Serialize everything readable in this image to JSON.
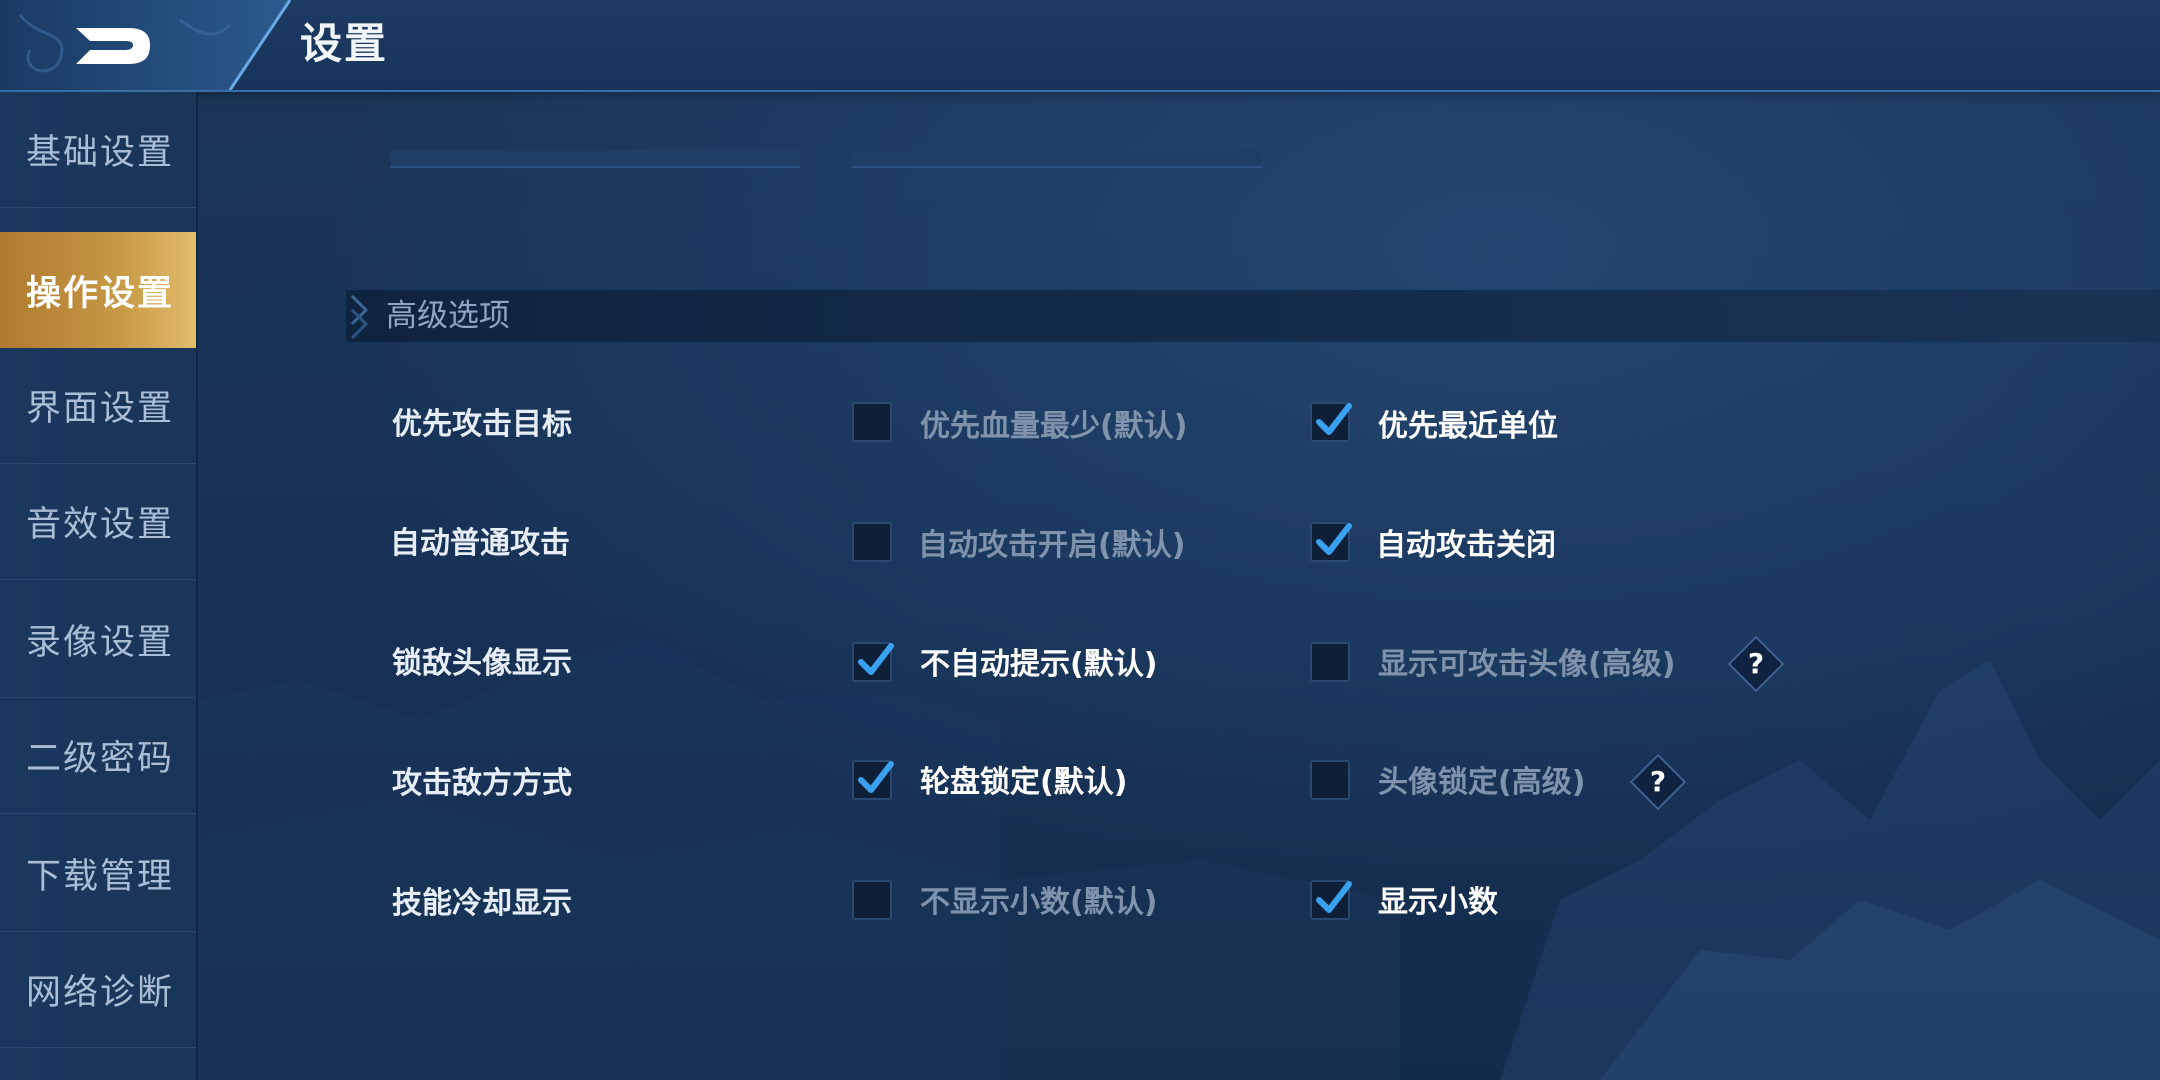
{
  "header": {
    "title": "设置",
    "back_icon": "back-arrow-icon"
  },
  "sidebar": {
    "items": [
      {
        "label": "基础设置",
        "active": false
      },
      {
        "label": "操作设置",
        "active": true
      },
      {
        "label": "界面设置",
        "active": false
      },
      {
        "label": "音效设置",
        "active": false
      },
      {
        "label": "录像设置",
        "active": false
      },
      {
        "label": "二级密码",
        "active": false
      },
      {
        "label": "下载管理",
        "active": false
      },
      {
        "label": "网络诊断",
        "active": false
      }
    ]
  },
  "section": {
    "title": "高级选项"
  },
  "settings": [
    {
      "label": "优先攻击目标",
      "options": [
        {
          "label": "优先血量最少(默认)",
          "checked": false
        },
        {
          "label": "优先最近单位",
          "checked": true
        }
      ]
    },
    {
      "label": "自动普通攻击",
      "options": [
        {
          "label": "自动攻击开启(默认)",
          "checked": false
        },
        {
          "label": "自动攻击关闭",
          "checked": true
        }
      ]
    },
    {
      "label": "锁敌头像显示",
      "options": [
        {
          "label": "不自动提示(默认)",
          "checked": true
        },
        {
          "label": "显示可攻击头像(高级)",
          "checked": false,
          "help": "?"
        }
      ]
    },
    {
      "label": "攻击敌方方式",
      "options": [
        {
          "label": "轮盘锁定(默认)",
          "checked": true
        },
        {
          "label": "头像锁定(高级)",
          "checked": false,
          "help": "?"
        }
      ]
    },
    {
      "label": "技能冷却显示",
      "options": [
        {
          "label": "不显示小数(默认)",
          "checked": false
        },
        {
          "label": "显示小数",
          "checked": true
        }
      ]
    }
  ],
  "colors": {
    "accent_gold": "#c69845",
    "check_blue": "#3aa0f0",
    "background": "#173256"
  }
}
